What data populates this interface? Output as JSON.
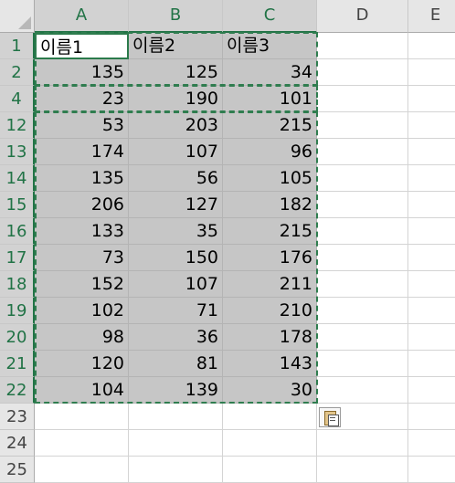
{
  "columns": [
    "A",
    "B",
    "C",
    "D",
    "E"
  ],
  "rows": [
    {
      "num": "1",
      "cells": [
        "이름1",
        "이름2",
        "이름3"
      ]
    },
    {
      "num": "2",
      "cells": [
        "135",
        "125",
        "34"
      ]
    },
    {
      "num": "4",
      "cells": [
        "23",
        "190",
        "101"
      ]
    },
    {
      "num": "12",
      "cells": [
        "53",
        "203",
        "215"
      ]
    },
    {
      "num": "13",
      "cells": [
        "174",
        "107",
        "96"
      ]
    },
    {
      "num": "14",
      "cells": [
        "135",
        "56",
        "105"
      ]
    },
    {
      "num": "15",
      "cells": [
        "206",
        "127",
        "182"
      ]
    },
    {
      "num": "16",
      "cells": [
        "133",
        "35",
        "215"
      ]
    },
    {
      "num": "17",
      "cells": [
        "73",
        "150",
        "176"
      ]
    },
    {
      "num": "18",
      "cells": [
        "152",
        "107",
        "211"
      ]
    },
    {
      "num": "19",
      "cells": [
        "102",
        "71",
        "210"
      ]
    },
    {
      "num": "20",
      "cells": [
        "98",
        "36",
        "178"
      ]
    },
    {
      "num": "21",
      "cells": [
        "120",
        "81",
        "143"
      ]
    },
    {
      "num": "22",
      "cells": [
        "104",
        "139",
        "30"
      ]
    },
    {
      "num": "23",
      "cells": [
        "",
        "",
        ""
      ]
    },
    {
      "num": "24",
      "cells": [
        "",
        "",
        ""
      ]
    },
    {
      "num": "25",
      "cells": [
        "",
        "",
        ""
      ]
    }
  ],
  "selected_rows": 14,
  "active_cell": "A1",
  "paste_options_icon": "clipboard-paste-icon",
  "colors": {
    "accent": "#217346",
    "selection_fill": "#c6c6c6",
    "marquee": "#2f7d4f",
    "header_bg": "#e6e6e6"
  }
}
